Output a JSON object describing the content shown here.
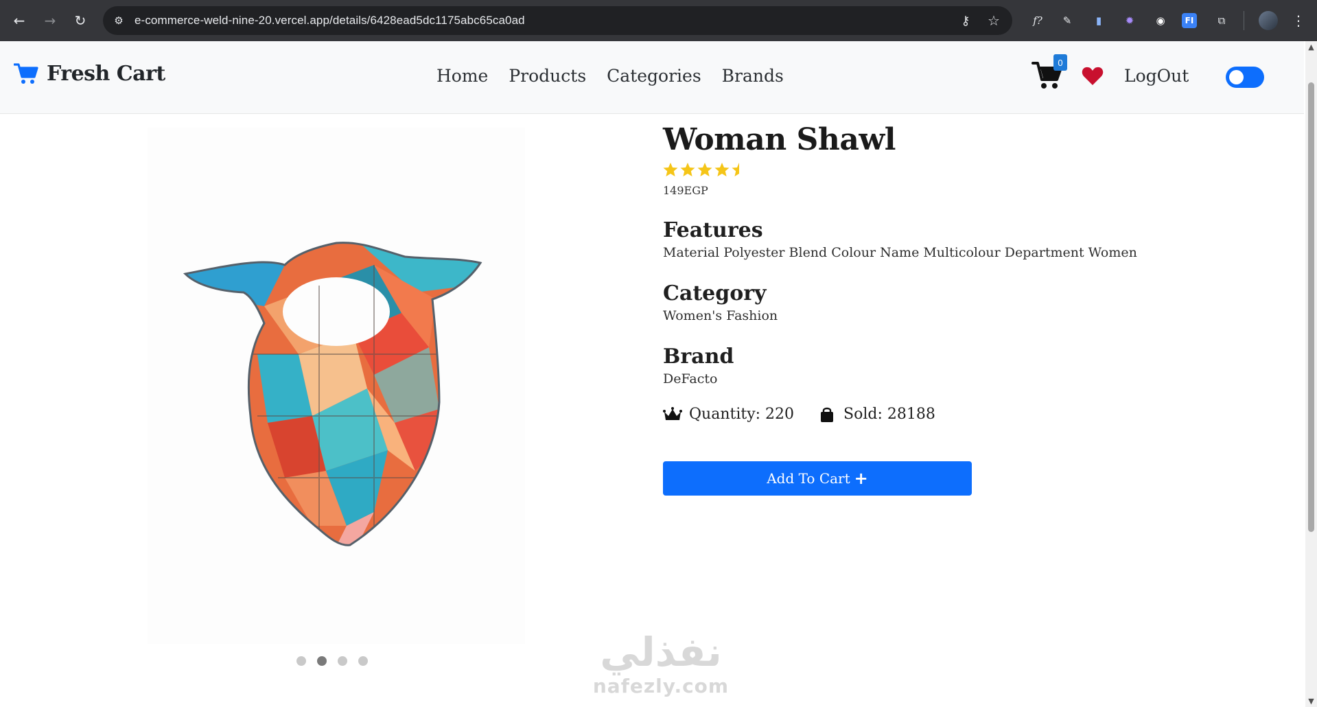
{
  "browser": {
    "url": "e-commerce-weld-nine-20.vercel.app/details/6428ead5dc1175abc65ca0ad",
    "icons": {
      "back": "arrow-left-icon",
      "forward": "arrow-right-icon",
      "reload": "reload-icon",
      "site_info": "tune-icon",
      "passwords": "key-icon",
      "bookmark": "star-icon"
    },
    "extensions": [
      {
        "name": "font-extension-icon",
        "glyph": "f?",
        "color": "#e8eaed",
        "bg": "transparent"
      },
      {
        "name": "eyedropper-extension-icon",
        "glyph": "✎",
        "color": "#e8eaed",
        "bg": "transparent"
      },
      {
        "name": "docs-extension-icon",
        "glyph": "▮",
        "color": "#8ab4f8",
        "bg": "transparent"
      },
      {
        "name": "gear-extension-icon",
        "glyph": "✹",
        "color": "#a78bfa",
        "bg": "transparent"
      },
      {
        "name": "circle-extension-icon",
        "glyph": "◉",
        "color": "#ffffff",
        "bg": "transparent"
      },
      {
        "name": "fi-extension-icon",
        "glyph": "FI",
        "color": "#ffffff",
        "bg": "#3b82f6"
      },
      {
        "name": "puzzle-extension-icon",
        "glyph": "⧉",
        "color": "#e8eaed",
        "bg": "transparent"
      }
    ]
  },
  "navbar": {
    "brand": "Fresh Cart",
    "links": [
      "Home",
      "Products",
      "Categories",
      "Brands"
    ],
    "cart_count": "0",
    "logout": "LogOut",
    "dark_mode_on": false,
    "accent": "#0d6efd",
    "wishlist_color": "#c8102e"
  },
  "product": {
    "title": "Woman Shawl",
    "rating": 4.5,
    "rating_color": "#f5c518",
    "price": "149EGP",
    "features_heading": "Features",
    "features": "Material Polyester Blend Colour Name Multicolour Department Women",
    "category_heading": "Category",
    "category": "Women's Fashion",
    "brand_heading": "Brand",
    "brand": "DeFacto",
    "quantity": "Quantity: 220",
    "sold": "Sold: 28188",
    "add_to_cart": "Add To Cart",
    "image_alt": "scarf-image",
    "slider_dots": 4,
    "active_slide": 2
  },
  "watermark": {
    "arabic": "نفذلي",
    "latin": "nafezly.com"
  }
}
